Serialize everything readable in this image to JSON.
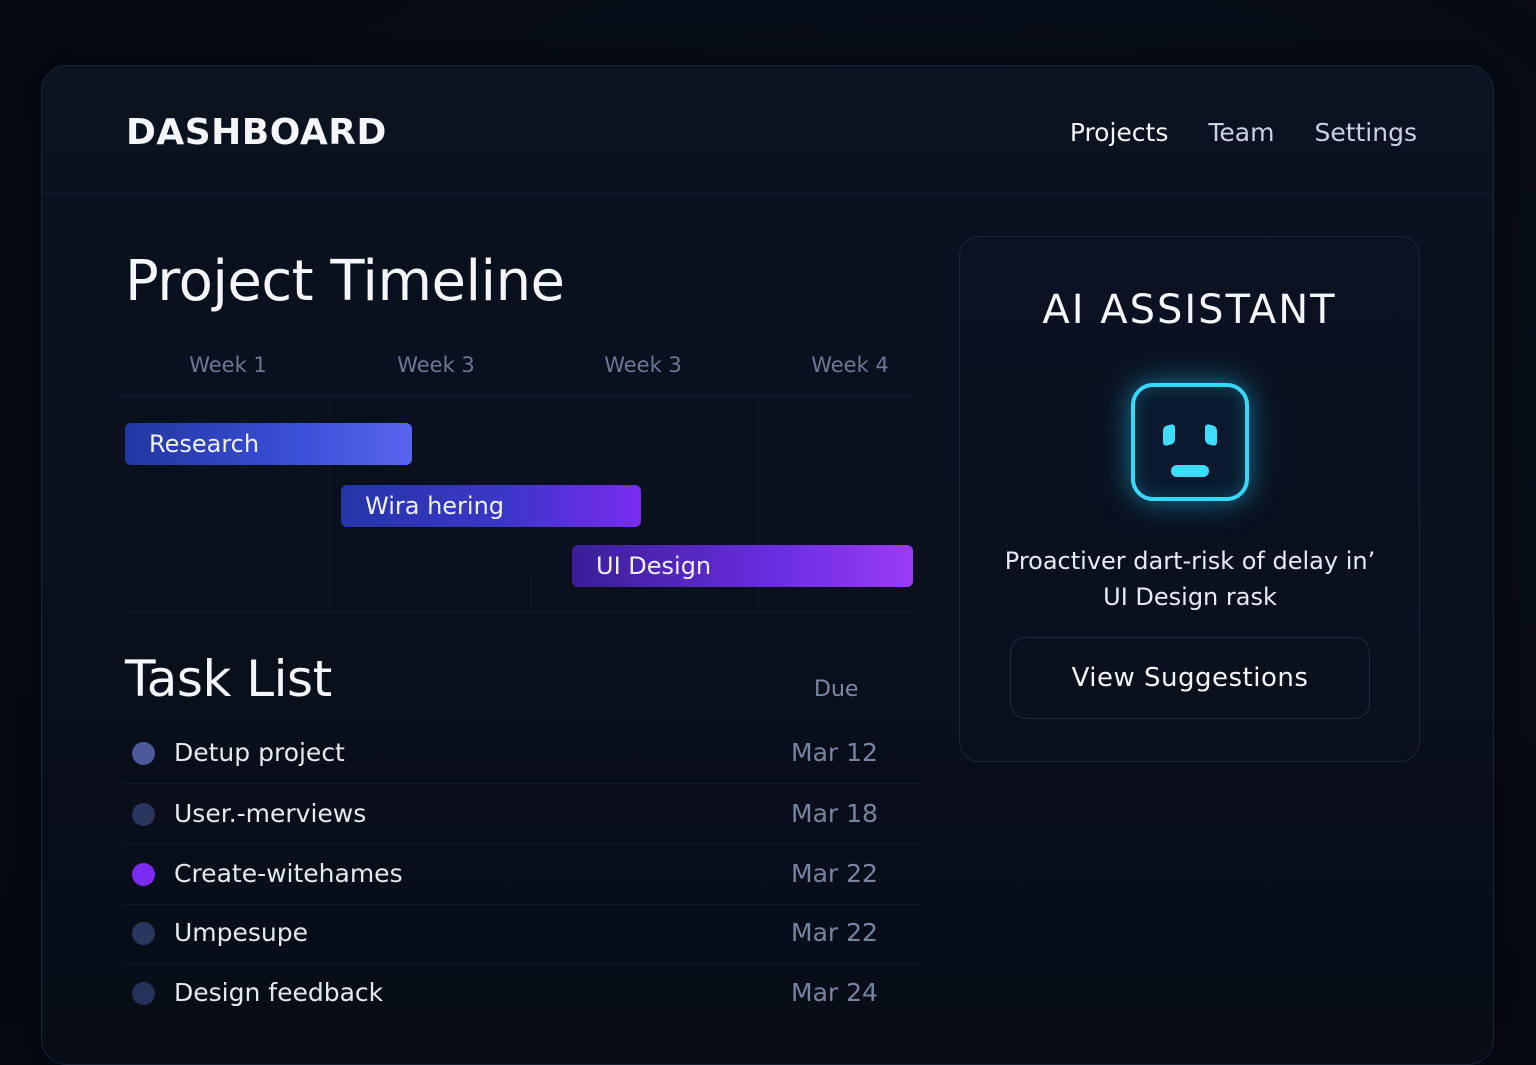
{
  "header": {
    "brand": "DASHBOARD",
    "nav": [
      "Projects",
      "Team",
      "Settings"
    ]
  },
  "timeline": {
    "title": "Project Timeline",
    "weeks": [
      "Week 1",
      "Week 3",
      "Week 3",
      "Week 4"
    ],
    "bars": [
      {
        "label": "Research"
      },
      {
        "label": "Wira hering"
      },
      {
        "label": "UI Design"
      }
    ]
  },
  "tasks": {
    "title": "Task List",
    "due_header": "Due",
    "rows": [
      {
        "name": "Detup project",
        "due": "Mar 12",
        "color": "#4a5a9a"
      },
      {
        "name": "User.-merviews",
        "due": "Mar 18",
        "color": "#2a365e"
      },
      {
        "name": "Create-witehames",
        "due": "Mar 22",
        "color": "#7c2cf0"
      },
      {
        "name": "Umpesupe",
        "due": "Mar 22",
        "color": "#2a365e"
      },
      {
        "name": "Design feedback",
        "due": "Mar 24",
        "color": "#26325a"
      }
    ]
  },
  "assistant": {
    "title": "AI ASSISTANT",
    "icon": "robot-face-icon",
    "message": "Proactiver dart-risk of delay in’ UI Design rask",
    "button": "View Suggestions"
  }
}
